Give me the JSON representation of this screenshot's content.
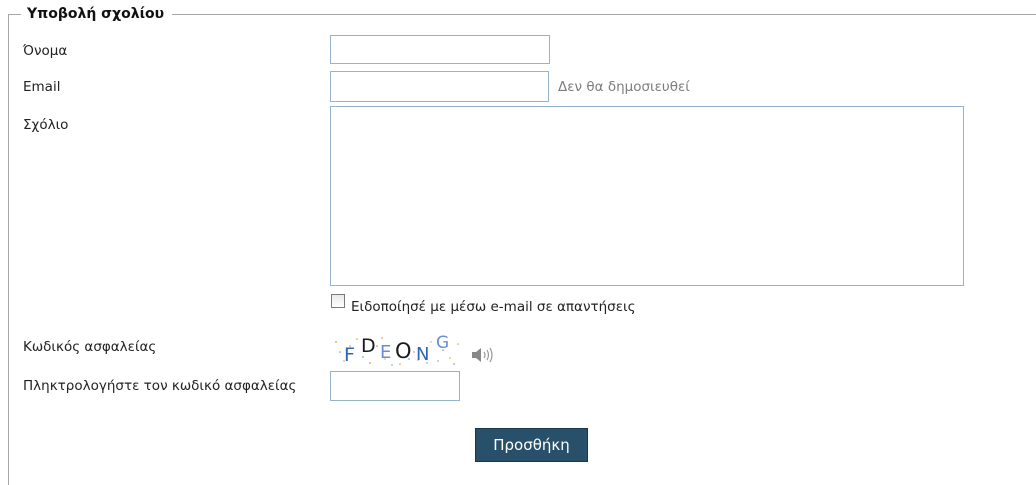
{
  "form": {
    "legend": "Υποβολή σχολίου",
    "name_label": "Όνομα",
    "name_value": "",
    "email_label": "Email",
    "email_value": "",
    "email_hint": "Δεν θα δημοσιευθεί",
    "comment_label": "Σχόλιο",
    "comment_value": "",
    "notify_label": "Ειδοποίησέ με μέσω e-mail σε απαντήσεις",
    "notify_checked": false,
    "captcha_label": "Κωδικός ασφαλείας",
    "captcha_text": "FDEONG",
    "captcha_audio_icon": "speaker-icon",
    "captcha_input_label": "Πληκτρολογήστε τον κωδικό ασφαλείας",
    "captcha_input_value": "",
    "submit_label": "Προσθήκη"
  },
  "colors": {
    "input_border": "#94b4cb",
    "button_bg": "#29506a",
    "hint_text": "#7d7d7d"
  }
}
